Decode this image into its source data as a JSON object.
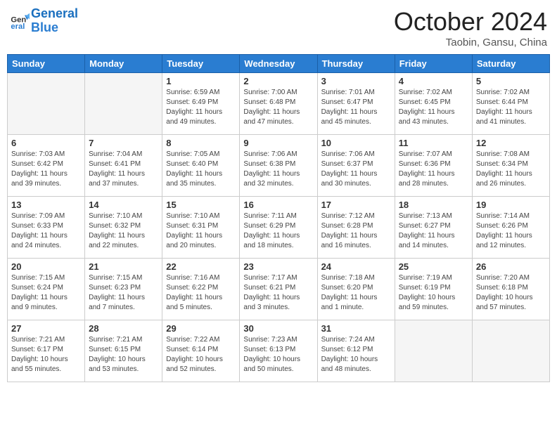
{
  "header": {
    "logo_line1": "General",
    "logo_line2": "Blue",
    "month": "October 2024",
    "location": "Taobin, Gansu, China"
  },
  "weekdays": [
    "Sunday",
    "Monday",
    "Tuesday",
    "Wednesday",
    "Thursday",
    "Friday",
    "Saturday"
  ],
  "weeks": [
    [
      {
        "day": "",
        "info": ""
      },
      {
        "day": "",
        "info": ""
      },
      {
        "day": "1",
        "info": "Sunrise: 6:59 AM\nSunset: 6:49 PM\nDaylight: 11 hours and 49 minutes."
      },
      {
        "day": "2",
        "info": "Sunrise: 7:00 AM\nSunset: 6:48 PM\nDaylight: 11 hours and 47 minutes."
      },
      {
        "day": "3",
        "info": "Sunrise: 7:01 AM\nSunset: 6:47 PM\nDaylight: 11 hours and 45 minutes."
      },
      {
        "day": "4",
        "info": "Sunrise: 7:02 AM\nSunset: 6:45 PM\nDaylight: 11 hours and 43 minutes."
      },
      {
        "day": "5",
        "info": "Sunrise: 7:02 AM\nSunset: 6:44 PM\nDaylight: 11 hours and 41 minutes."
      }
    ],
    [
      {
        "day": "6",
        "info": "Sunrise: 7:03 AM\nSunset: 6:42 PM\nDaylight: 11 hours and 39 minutes."
      },
      {
        "day": "7",
        "info": "Sunrise: 7:04 AM\nSunset: 6:41 PM\nDaylight: 11 hours and 37 minutes."
      },
      {
        "day": "8",
        "info": "Sunrise: 7:05 AM\nSunset: 6:40 PM\nDaylight: 11 hours and 35 minutes."
      },
      {
        "day": "9",
        "info": "Sunrise: 7:06 AM\nSunset: 6:38 PM\nDaylight: 11 hours and 32 minutes."
      },
      {
        "day": "10",
        "info": "Sunrise: 7:06 AM\nSunset: 6:37 PM\nDaylight: 11 hours and 30 minutes."
      },
      {
        "day": "11",
        "info": "Sunrise: 7:07 AM\nSunset: 6:36 PM\nDaylight: 11 hours and 28 minutes."
      },
      {
        "day": "12",
        "info": "Sunrise: 7:08 AM\nSunset: 6:34 PM\nDaylight: 11 hours and 26 minutes."
      }
    ],
    [
      {
        "day": "13",
        "info": "Sunrise: 7:09 AM\nSunset: 6:33 PM\nDaylight: 11 hours and 24 minutes."
      },
      {
        "day": "14",
        "info": "Sunrise: 7:10 AM\nSunset: 6:32 PM\nDaylight: 11 hours and 22 minutes."
      },
      {
        "day": "15",
        "info": "Sunrise: 7:10 AM\nSunset: 6:31 PM\nDaylight: 11 hours and 20 minutes."
      },
      {
        "day": "16",
        "info": "Sunrise: 7:11 AM\nSunset: 6:29 PM\nDaylight: 11 hours and 18 minutes."
      },
      {
        "day": "17",
        "info": "Sunrise: 7:12 AM\nSunset: 6:28 PM\nDaylight: 11 hours and 16 minutes."
      },
      {
        "day": "18",
        "info": "Sunrise: 7:13 AM\nSunset: 6:27 PM\nDaylight: 11 hours and 14 minutes."
      },
      {
        "day": "19",
        "info": "Sunrise: 7:14 AM\nSunset: 6:26 PM\nDaylight: 11 hours and 12 minutes."
      }
    ],
    [
      {
        "day": "20",
        "info": "Sunrise: 7:15 AM\nSunset: 6:24 PM\nDaylight: 11 hours and 9 minutes."
      },
      {
        "day": "21",
        "info": "Sunrise: 7:15 AM\nSunset: 6:23 PM\nDaylight: 11 hours and 7 minutes."
      },
      {
        "day": "22",
        "info": "Sunrise: 7:16 AM\nSunset: 6:22 PM\nDaylight: 11 hours and 5 minutes."
      },
      {
        "day": "23",
        "info": "Sunrise: 7:17 AM\nSunset: 6:21 PM\nDaylight: 11 hours and 3 minutes."
      },
      {
        "day": "24",
        "info": "Sunrise: 7:18 AM\nSunset: 6:20 PM\nDaylight: 11 hours and 1 minute."
      },
      {
        "day": "25",
        "info": "Sunrise: 7:19 AM\nSunset: 6:19 PM\nDaylight: 10 hours and 59 minutes."
      },
      {
        "day": "26",
        "info": "Sunrise: 7:20 AM\nSunset: 6:18 PM\nDaylight: 10 hours and 57 minutes."
      }
    ],
    [
      {
        "day": "27",
        "info": "Sunrise: 7:21 AM\nSunset: 6:17 PM\nDaylight: 10 hours and 55 minutes."
      },
      {
        "day": "28",
        "info": "Sunrise: 7:21 AM\nSunset: 6:15 PM\nDaylight: 10 hours and 53 minutes."
      },
      {
        "day": "29",
        "info": "Sunrise: 7:22 AM\nSunset: 6:14 PM\nDaylight: 10 hours and 52 minutes."
      },
      {
        "day": "30",
        "info": "Sunrise: 7:23 AM\nSunset: 6:13 PM\nDaylight: 10 hours and 50 minutes."
      },
      {
        "day": "31",
        "info": "Sunrise: 7:24 AM\nSunset: 6:12 PM\nDaylight: 10 hours and 48 minutes."
      },
      {
        "day": "",
        "info": ""
      },
      {
        "day": "",
        "info": ""
      }
    ]
  ]
}
